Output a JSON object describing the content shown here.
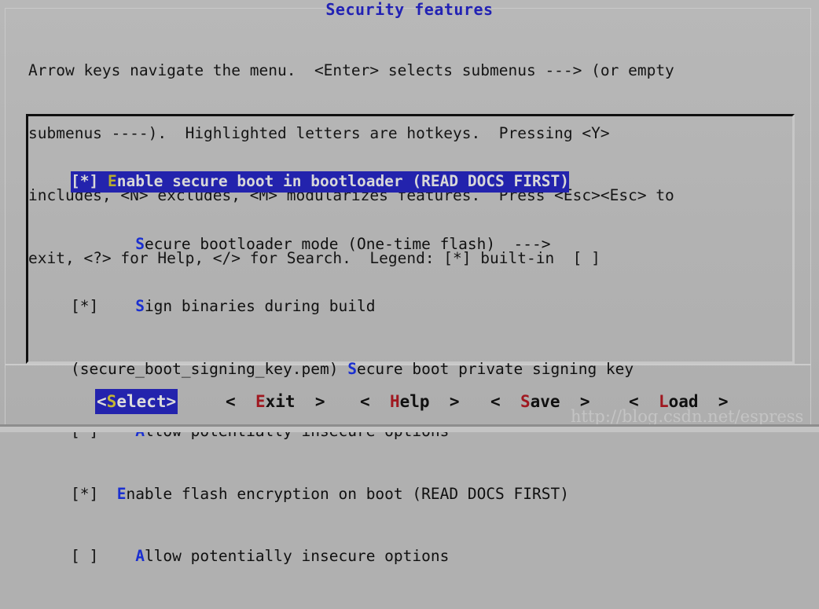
{
  "window": {
    "title": "Security features",
    "background_color": "#b2b2b2",
    "title_color": "#2222b4",
    "highlight_color": "#2323ad",
    "hotkey_color": "#1a2fd0",
    "selected_hotkey_color": "#b8ae2e",
    "button_hotkey_color": "#a01820"
  },
  "help": {
    "line1": "Arrow keys navigate the menu.  <Enter> selects submenus ---> (or empty",
    "line2": "submenus ----).  Highlighted letters are hotkeys.  Pressing <Y>",
    "line3": "includes, <N> excludes, <M> modularizes features.  Press <Esc><Esc> to",
    "line4": "exit, <?> for Help, </> for Search.  Legend: [*] built-in  [ ]"
  },
  "menu": {
    "items": [
      {
        "prefix": "[*] ",
        "hotkey": "E",
        "rest": "nable secure boot in bootloader (READ DOCS FIRST)",
        "state": "[*]",
        "selected": true,
        "full_text": "[*] Enable secure boot in bootloader (READ DOCS FIRST)"
      },
      {
        "prefix": "       ",
        "hotkey": "S",
        "rest": "ecure bootloader mode (One-time flash)  --->",
        "state": "submenu",
        "selected": false,
        "full_text": "       Secure bootloader mode (One-time flash)  --->"
      },
      {
        "prefix": "[*]    ",
        "hotkey": "S",
        "rest": "ign binaries during build",
        "state": "[*]",
        "selected": false,
        "full_text": "[*]    Sign binaries during build"
      },
      {
        "prefix": "(secure_boot_signing_key.pem) ",
        "hotkey": "S",
        "rest": "ecure boot private signing key",
        "state": "(secure_boot_signing_key.pem)",
        "selected": false,
        "full_text": "(secure_boot_signing_key.pem) Secure boot private signing key"
      },
      {
        "prefix": "[ ]    ",
        "hotkey": "A",
        "rest": "llow potentially insecure options",
        "state": "[ ]",
        "selected": false,
        "full_text": "[ ]    Allow potentially insecure options"
      },
      {
        "prefix": "[*]  ",
        "hotkey": "E",
        "rest": "nable flash encryption on boot (READ DOCS FIRST)",
        "state": "[*]",
        "selected": false,
        "full_text": "[*]  Enable flash encryption on boot (READ DOCS FIRST)"
      },
      {
        "prefix": "[ ]    ",
        "hotkey": "A",
        "rest": "llow potentially insecure options",
        "state": "[ ]",
        "selected": false,
        "full_text": "[ ]    Allow potentially insecure options"
      }
    ]
  },
  "buttons": {
    "select": {
      "open": "<",
      "hotkey": "S",
      "rest": "elect",
      "close": ">",
      "label": "<Select>",
      "active": true
    },
    "exit": {
      "open": "<  ",
      "hotkey": "E",
      "rest": "xit",
      "close": "  >",
      "label": "<  Exit  >",
      "active": false
    },
    "help": {
      "open": "<  ",
      "hotkey": "H",
      "rest": "elp",
      "close": "  >",
      "label": "<  Help  >",
      "active": false
    },
    "save": {
      "open": "<  ",
      "hotkey": "S",
      "rest": "ave",
      "close": "  >",
      "label": "<  Save  >",
      "active": false
    },
    "load": {
      "open": "<  ",
      "hotkey": "L",
      "rest": "oad",
      "close": "  >",
      "label": "<  Load  >",
      "active": false
    }
  },
  "watermark": {
    "text": "http://blog.csdn.net/espress"
  }
}
